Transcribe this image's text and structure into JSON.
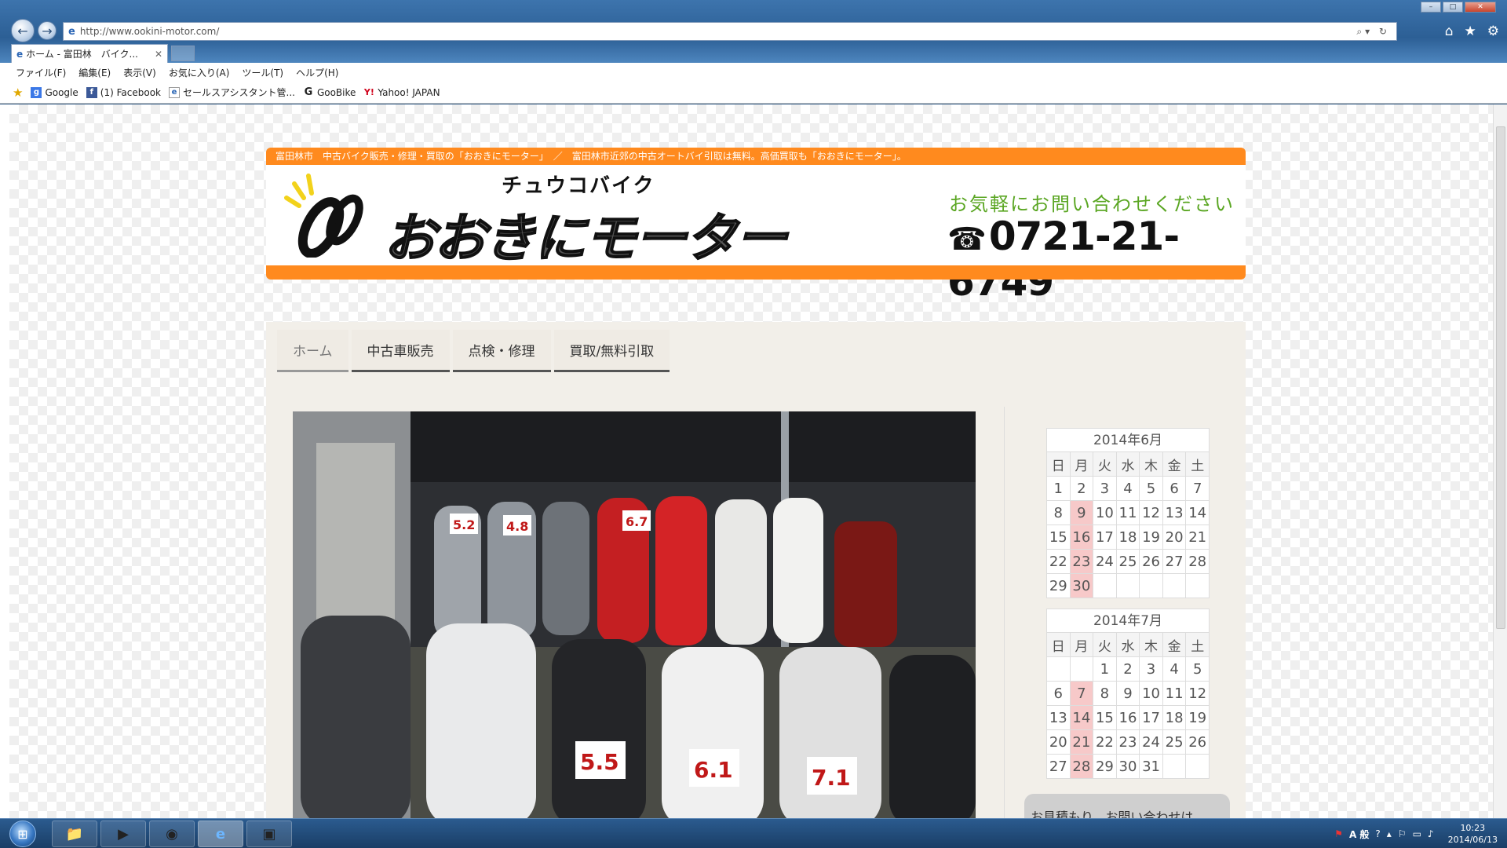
{
  "browser": {
    "url": "http://www.ookini-motor.com/",
    "tab_title": "ホーム - 富田林　バイク...",
    "menu": [
      "ファイル(F)",
      "編集(E)",
      "表示(V)",
      "お気に入り(A)",
      "ツール(T)",
      "ヘルプ(H)"
    ],
    "favorites": [
      {
        "label": "Google",
        "icon": "google-icon",
        "color": "#3b78e7"
      },
      {
        "label": "(1) Facebook",
        "icon": "facebook-icon",
        "color": "#3b5998"
      },
      {
        "label": "セールスアシスタント管...",
        "icon": "ie-page-icon",
        "color": "#e8a317"
      },
      {
        "label": "GooBike",
        "icon": "goobike-icon",
        "color": "#222222"
      },
      {
        "label": "Yahoo! JAPAN",
        "icon": "yahoo-icon",
        "color": "#d0021b"
      }
    ]
  },
  "site": {
    "tagline": "富田林市　中古バイク販売・修理・買取の「おおきにモーター」　／　富田林市近郊の中古オートバイ引取は無料。高価買取も「おおきにモーター」。",
    "logo_kana": "チュウコバイク",
    "logo_name": "おおきにモーター",
    "contact_call": "お気軽にお問い合わせください",
    "phone": "0721-21-6749",
    "accent": "#ff8a1e",
    "nav": [
      "ホーム",
      "中古車販売",
      "点検・修理",
      "買取/無料引取"
    ],
    "estimate_heading": "お見積もり、お問い合わせは"
  },
  "calendars": [
    {
      "caption": "2014年6月",
      "weekdays": [
        "日",
        "月",
        "火",
        "水",
        "木",
        "金",
        "土"
      ],
      "weeks": [
        [
          "1",
          "2",
          "3",
          "4",
          "5",
          "6",
          "7"
        ],
        [
          "8",
          "9",
          "10",
          "11",
          "12",
          "13",
          "14"
        ],
        [
          "15",
          "16",
          "17",
          "18",
          "19",
          "20",
          "21"
        ],
        [
          "22",
          "23",
          "24",
          "25",
          "26",
          "27",
          "28"
        ],
        [
          "29",
          "30",
          "",
          "",
          "",
          "",
          ""
        ]
      ],
      "highlighted": [
        "9",
        "16",
        "23",
        "30"
      ]
    },
    {
      "caption": "2014年7月",
      "weekdays": [
        "日",
        "月",
        "火",
        "水",
        "木",
        "金",
        "土"
      ],
      "weeks": [
        [
          "",
          "",
          "1",
          "2",
          "3",
          "4",
          "5"
        ],
        [
          "6",
          "7",
          "8",
          "9",
          "10",
          "11",
          "12"
        ],
        [
          "13",
          "14",
          "15",
          "16",
          "17",
          "18",
          "19"
        ],
        [
          "20",
          "21",
          "22",
          "23",
          "24",
          "25",
          "26"
        ],
        [
          "27",
          "28",
          "29",
          "30",
          "31",
          "",
          ""
        ]
      ],
      "highlighted": [
        "7",
        "14",
        "21",
        "28"
      ]
    }
  ],
  "hero_price_tags": [
    "5.2",
    "4.8",
    "6.7",
    "5.5",
    "6.1",
    "7.1"
  ],
  "taskbar": {
    "apps": [
      "explorer-icon",
      "media-player-icon",
      "chrome-icon",
      "ie-icon",
      "app-icon"
    ],
    "ime": "A 般",
    "time": "10:23",
    "date": "2014/06/13"
  }
}
